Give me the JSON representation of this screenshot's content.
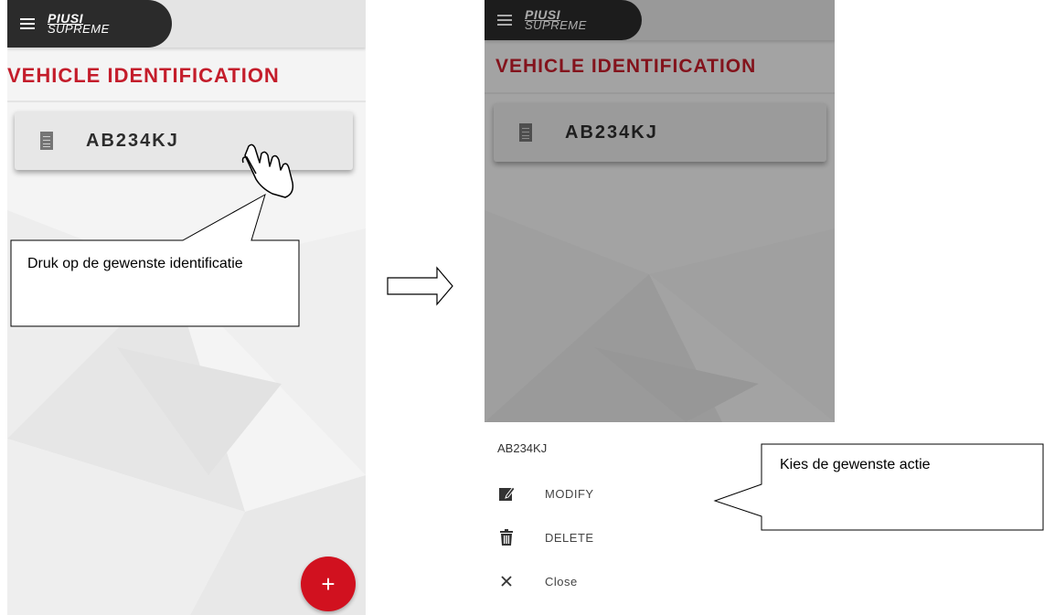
{
  "left_screen": {
    "logo_line1": "PIUSI",
    "logo_line2": "SUPREME",
    "page_title": "VEHICLE IDENTIFICATION",
    "card_plate": "AB234KJ",
    "fab_label": "+",
    "callout_text": "Druk op de gewenste identificatie"
  },
  "right_screen": {
    "logo_line1": "PIUSI",
    "logo_line2": "SUPREME",
    "page_title": "VEHICLE IDENTIFICATION",
    "card_plate": "AB234KJ",
    "sheet": {
      "title": "AB234KJ",
      "items": [
        {
          "label": "MODIFY",
          "icon": "edit-icon"
        },
        {
          "label": "DELETE",
          "icon": "trash-icon"
        },
        {
          "label": "Close",
          "icon": "close-icon"
        }
      ]
    },
    "callout_text": "Kies de gewenste actie"
  },
  "colors": {
    "accent_red": "#c41d2b",
    "fab_red": "#d1111f",
    "topbar_dark": "#2b2b2b"
  }
}
